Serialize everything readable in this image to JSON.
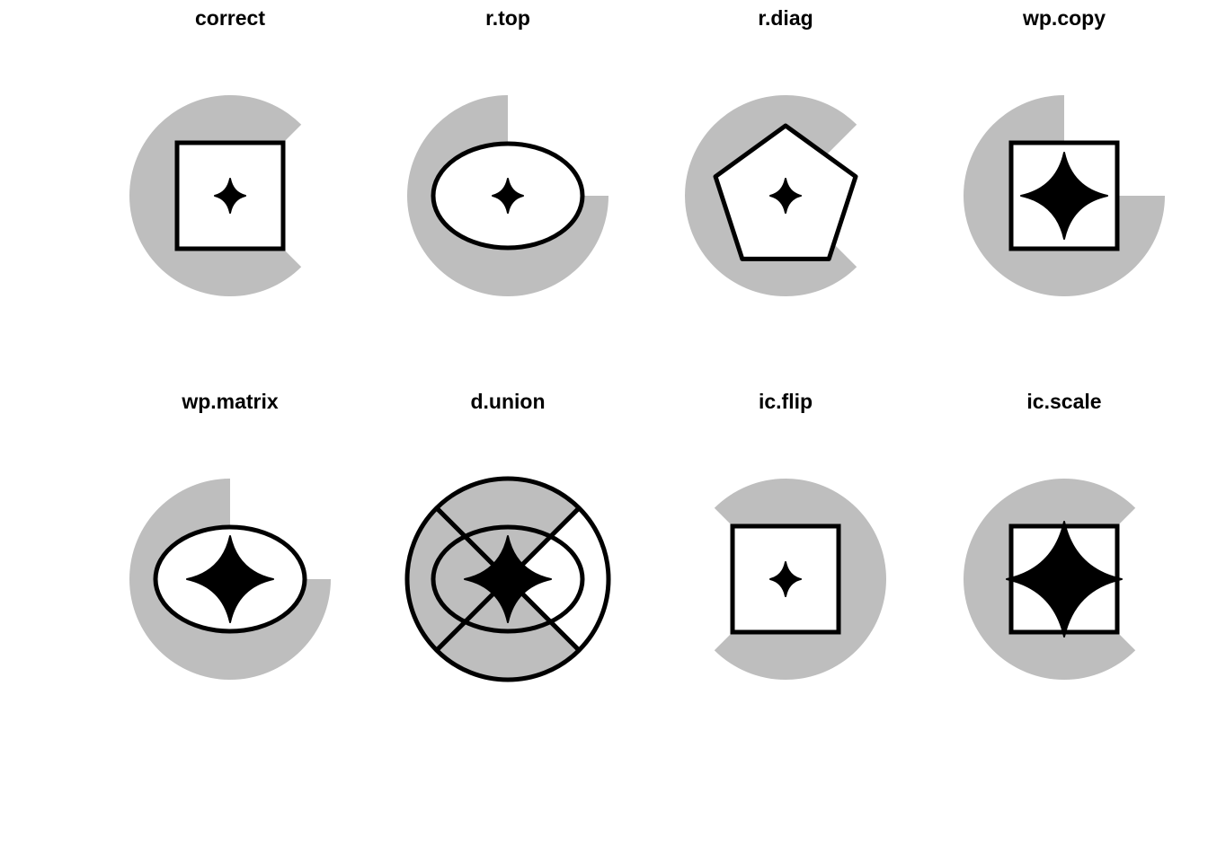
{
  "colors": {
    "background": "#ffffff",
    "wedge_fill": "#bebebe",
    "stroke": "#000000",
    "star_fill": "#000000",
    "shape_fill": "#ffffff"
  },
  "panels": [
    {
      "title": "correct",
      "wedge": "correct",
      "frame": "square",
      "star": "small"
    },
    {
      "title": "r.top",
      "wedge": "top",
      "frame": "ellipse",
      "star": "small"
    },
    {
      "title": "r.diag",
      "wedge": "correct",
      "frame": "pentagon",
      "star": "small"
    },
    {
      "title": "wp.copy",
      "wedge": "quarter",
      "frame": "square",
      "star": "large"
    },
    {
      "title": "wp.matrix",
      "wedge": "quarter",
      "frame": "ellipse",
      "star": "large"
    },
    {
      "title": "d.union",
      "wedge": "ring",
      "frame": "ellipse",
      "star": "large"
    },
    {
      "title": "ic.flip",
      "wedge": "flip",
      "frame": "square",
      "star": "small"
    },
    {
      "title": "ic.scale",
      "wedge": "correct",
      "frame": "square",
      "star": "xlarge"
    }
  ]
}
